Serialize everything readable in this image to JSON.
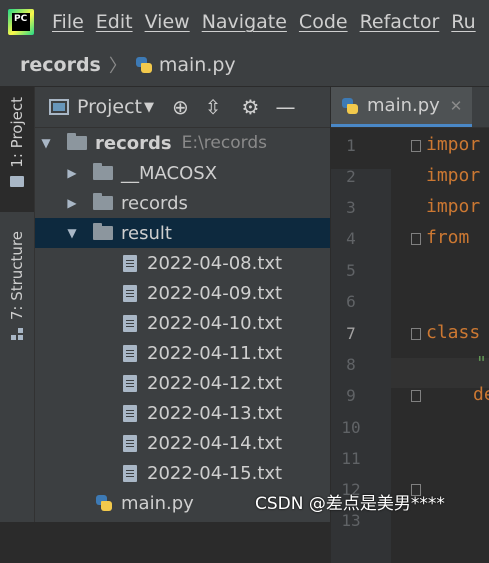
{
  "menu": {
    "logo_text": "PC",
    "items": [
      "File",
      "Edit",
      "View",
      "Navigate",
      "Code",
      "Refactor",
      "Ru"
    ]
  },
  "breadcrumb": {
    "root": "records",
    "file": "main.py"
  },
  "left_strip": {
    "project_tab": "1: Project",
    "structure_tab": "7: Structure"
  },
  "project_panel": {
    "title": "Project",
    "tree": [
      {
        "label": "records",
        "extra": "E:\\records",
        "type": "root"
      },
      {
        "label": "__MACOSX",
        "type": "folder"
      },
      {
        "label": "records",
        "type": "folder"
      },
      {
        "label": "result",
        "type": "folder-open"
      },
      {
        "label": "2022-04-08.txt",
        "type": "txt"
      },
      {
        "label": "2022-04-09.txt",
        "type": "txt"
      },
      {
        "label": "2022-04-10.txt",
        "type": "txt"
      },
      {
        "label": "2022-04-11.txt",
        "type": "txt"
      },
      {
        "label": "2022-04-12.txt",
        "type": "txt"
      },
      {
        "label": "2022-04-13.txt",
        "type": "txt"
      },
      {
        "label": "2022-04-14.txt",
        "type": "txt"
      },
      {
        "label": "2022-04-15.txt",
        "type": "txt"
      },
      {
        "label": "main.py",
        "type": "py"
      }
    ]
  },
  "editor": {
    "tab_label": "main.py",
    "line_numbers": [
      "1",
      "2",
      "3",
      "4",
      "5",
      "6",
      "7",
      "8",
      "9",
      "10",
      "11",
      "12",
      "13"
    ],
    "code": [
      "impor",
      "impor",
      "impor",
      "from ",
      "",
      "",
      "class",
      "\"",
      "de",
      "",
      "",
      "",
      ""
    ]
  },
  "watermark": "CSDN @差点是美男****"
}
